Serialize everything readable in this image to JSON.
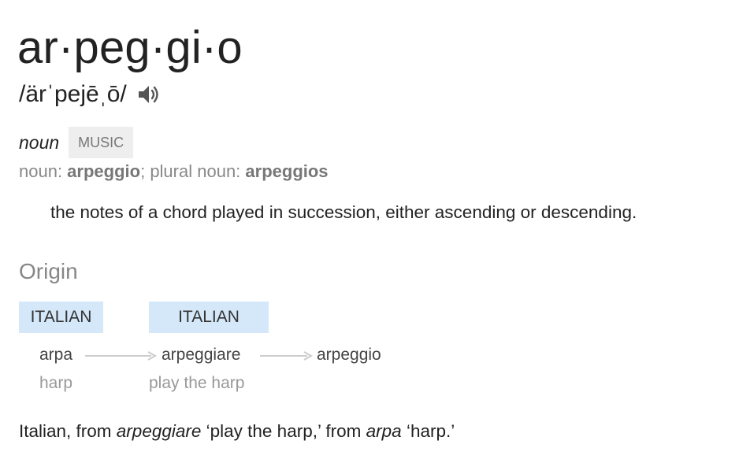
{
  "entry": {
    "headword": "ar·peg·gi·o",
    "pronunciation": "/ärˈpejēˌō/",
    "speaker_icon": "volume-up-icon"
  },
  "sense": {
    "part_of_speech": "noun",
    "subject": "MUSIC",
    "forms": {
      "singular_label": "noun: ",
      "singular": "arpeggio",
      "separator": "; ",
      "plural_label": "plural noun: ",
      "plural": "arpeggios"
    },
    "definition": "the notes of a chord played in succession, either ascending or descending."
  },
  "origin": {
    "heading": "Origin",
    "languages": [
      "ITALIAN",
      "ITALIAN"
    ],
    "chain": [
      {
        "word": "arpa",
        "gloss": "harp"
      },
      {
        "word": "arpeggiare",
        "gloss": "play the harp"
      },
      {
        "word": "arpeggio",
        "gloss": ""
      }
    ],
    "text": {
      "p1": "Italian, from ",
      "w1": "arpeggiare",
      "p2": " ‘play the harp,’ from ",
      "w2": "arpa",
      "p3": " ‘harp.’"
    },
    "arrow_color": "#cccccc",
    "language_box_color": "#d4e8fa"
  }
}
